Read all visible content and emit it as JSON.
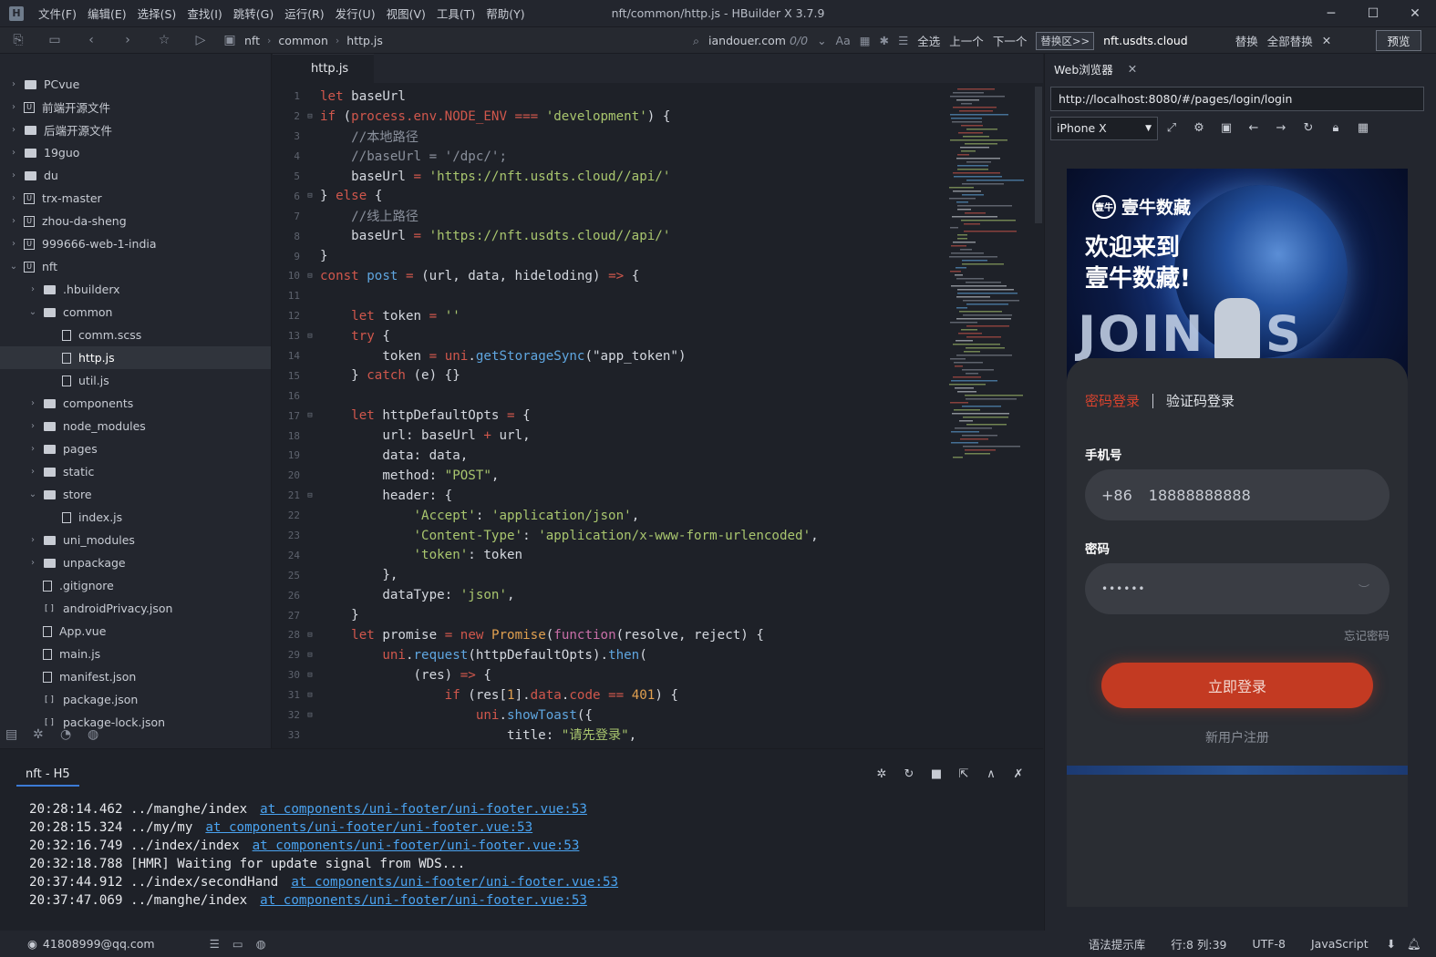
{
  "titlebar": {
    "menus": [
      "文件(F)",
      "编辑(E)",
      "选择(S)",
      "查找(I)",
      "跳转(G)",
      "运行(R)",
      "发行(U)",
      "视图(V)",
      "工具(T)",
      "帮助(Y)"
    ],
    "title": "nft/common/http.js - HBuilder X 3.7.9"
  },
  "toolbar": {
    "breadcrumb": [
      "nft",
      "common",
      "http.js"
    ],
    "find_text": "iandouer.com",
    "find_count": "0/0",
    "aa": "Aa",
    "select_all": "全选",
    "prev": "上一个",
    "next": "下一个",
    "replace_tag": "替换区>>",
    "replace_text": "nft.usdts.cloud",
    "replace": "替换",
    "replace_all": "全部替换",
    "preview": "预览"
  },
  "sidebar": {
    "items": [
      {
        "label": "PCvue",
        "depth": 0,
        "type": "folder",
        "chev": "›"
      },
      {
        "label": "前端开源文件",
        "depth": 0,
        "type": "proj",
        "chev": "›"
      },
      {
        "label": "后端开源文件",
        "depth": 0,
        "type": "folder",
        "chev": "›"
      },
      {
        "label": "19guo",
        "depth": 0,
        "type": "folder",
        "chev": "›"
      },
      {
        "label": "du",
        "depth": 0,
        "type": "folder",
        "chev": "›"
      },
      {
        "label": "trx-master",
        "depth": 0,
        "type": "proj",
        "chev": "›"
      },
      {
        "label": "zhou-da-sheng",
        "depth": 0,
        "type": "proj",
        "chev": "›"
      },
      {
        "label": "999666-web-1-india",
        "depth": 0,
        "type": "proj",
        "chev": "›"
      },
      {
        "label": "nft",
        "depth": 0,
        "type": "proj",
        "chev": "⌄"
      },
      {
        "label": ".hbuilderx",
        "depth": 1,
        "type": "folder",
        "chev": "›"
      },
      {
        "label": "common",
        "depth": 1,
        "type": "folder",
        "chev": "⌄"
      },
      {
        "label": "comm.scss",
        "depth": 2,
        "type": "file",
        "chev": ""
      },
      {
        "label": "http.js",
        "depth": 2,
        "type": "file",
        "chev": "",
        "selected": true
      },
      {
        "label": "util.js",
        "depth": 2,
        "type": "file",
        "chev": ""
      },
      {
        "label": "components",
        "depth": 1,
        "type": "folder",
        "chev": "›"
      },
      {
        "label": "node_modules",
        "depth": 1,
        "type": "folder",
        "chev": "›"
      },
      {
        "label": "pages",
        "depth": 1,
        "type": "folder",
        "chev": "›"
      },
      {
        "label": "static",
        "depth": 1,
        "type": "folder",
        "chev": "›"
      },
      {
        "label": "store",
        "depth": 1,
        "type": "folder",
        "chev": "⌄"
      },
      {
        "label": "index.js",
        "depth": 2,
        "type": "file",
        "chev": ""
      },
      {
        "label": "uni_modules",
        "depth": 1,
        "type": "folder",
        "chev": "›"
      },
      {
        "label": "unpackage",
        "depth": 1,
        "type": "folder",
        "chev": "›"
      },
      {
        "label": ".gitignore",
        "depth": 1,
        "type": "file",
        "chev": ""
      },
      {
        "label": "androidPrivacy.json",
        "depth": 1,
        "type": "json",
        "chev": ""
      },
      {
        "label": "App.vue",
        "depth": 1,
        "type": "file",
        "chev": ""
      },
      {
        "label": "main.js",
        "depth": 1,
        "type": "file",
        "chev": ""
      },
      {
        "label": "manifest.json",
        "depth": 1,
        "type": "file",
        "chev": ""
      },
      {
        "label": "package.json",
        "depth": 1,
        "type": "json",
        "chev": ""
      },
      {
        "label": "package-lock.json",
        "depth": 1,
        "type": "json",
        "chev": ""
      }
    ]
  },
  "editor": {
    "tab": "http.js",
    "lines": [
      [
        {
          "t": "let ",
          "c": "k"
        },
        {
          "t": "baseUrl",
          "c": "p"
        }
      ],
      [
        {
          "t": "if ",
          "c": "k"
        },
        {
          "t": "(",
          "c": "p"
        },
        {
          "t": "process.env.NODE_ENV ",
          "c": "pl"
        },
        {
          "t": "=== ",
          "c": "k"
        },
        {
          "t": "'development'",
          "c": "s"
        },
        {
          "t": ") {",
          "c": "p"
        }
      ],
      [
        {
          "t": "    //本地路径",
          "c": "c"
        }
      ],
      [
        {
          "t": "    //baseUrl = '/dpc/';",
          "c": "c"
        }
      ],
      [
        {
          "t": "    baseUrl ",
          "c": "p"
        },
        {
          "t": "= ",
          "c": "k"
        },
        {
          "t": "'https://nft.usdts.cloud//api/'",
          "c": "s"
        }
      ],
      [
        {
          "t": "} ",
          "c": "p"
        },
        {
          "t": "else ",
          "c": "k"
        },
        {
          "t": "{",
          "c": "p"
        }
      ],
      [
        {
          "t": "    //线上路径",
          "c": "c"
        }
      ],
      [
        {
          "t": "    baseUrl ",
          "c": "p"
        },
        {
          "t": "= ",
          "c": "k"
        },
        {
          "t": "'https://nft.usdts.cloud//api/'",
          "c": "s"
        }
      ],
      [
        {
          "t": "}",
          "c": "p"
        }
      ],
      [
        {
          "t": "const ",
          "c": "k"
        },
        {
          "t": "post ",
          "c": "f"
        },
        {
          "t": "= ",
          "c": "k"
        },
        {
          "t": "(url, data, hideloding) ",
          "c": "p"
        },
        {
          "t": "=> ",
          "c": "k"
        },
        {
          "t": "{",
          "c": "p"
        }
      ],
      [
        {
          "t": "",
          "c": "p"
        }
      ],
      [
        {
          "t": "    let ",
          "c": "k"
        },
        {
          "t": "token ",
          "c": "p"
        },
        {
          "t": "= ",
          "c": "k"
        },
        {
          "t": "''",
          "c": "s"
        }
      ],
      [
        {
          "t": "    try ",
          "c": "k"
        },
        {
          "t": "{",
          "c": "p"
        }
      ],
      [
        {
          "t": "        token ",
          "c": "p"
        },
        {
          "t": "= ",
          "c": "k"
        },
        {
          "t": "uni",
          "c": "pl"
        },
        {
          "t": ".",
          "c": "p"
        },
        {
          "t": "getStorageSync",
          "c": "f"
        },
        {
          "t": "(\"app_token\")",
          "c": "p"
        }
      ],
      [
        {
          "t": "    } ",
          "c": "p"
        },
        {
          "t": "catch ",
          "c": "k"
        },
        {
          "t": "(e) {}",
          "c": "p"
        }
      ],
      [
        {
          "t": "",
          "c": "p"
        }
      ],
      [
        {
          "t": "    let ",
          "c": "k"
        },
        {
          "t": "httpDefaultOpts ",
          "c": "p"
        },
        {
          "t": "= ",
          "c": "k"
        },
        {
          "t": "{",
          "c": "p"
        }
      ],
      [
        {
          "t": "        url: baseUrl ",
          "c": "p"
        },
        {
          "t": "+ ",
          "c": "k"
        },
        {
          "t": "url,",
          "c": "p"
        }
      ],
      [
        {
          "t": "        data: data,",
          "c": "p"
        }
      ],
      [
        {
          "t": "        method: ",
          "c": "p"
        },
        {
          "t": "\"POST\"",
          "c": "s"
        },
        {
          "t": ",",
          "c": "p"
        }
      ],
      [
        {
          "t": "        header: {",
          "c": "p"
        }
      ],
      [
        {
          "t": "            ",
          "c": "p"
        },
        {
          "t": "'Accept'",
          "c": "s"
        },
        {
          "t": ": ",
          "c": "p"
        },
        {
          "t": "'application/json'",
          "c": "s"
        },
        {
          "t": ",",
          "c": "p"
        }
      ],
      [
        {
          "t": "            ",
          "c": "p"
        },
        {
          "t": "'Content-Type'",
          "c": "s"
        },
        {
          "t": ": ",
          "c": "p"
        },
        {
          "t": "'application/x-www-form-urlencoded'",
          "c": "s"
        },
        {
          "t": ",",
          "c": "p"
        }
      ],
      [
        {
          "t": "            ",
          "c": "p"
        },
        {
          "t": "'token'",
          "c": "s"
        },
        {
          "t": ": token",
          "c": "p"
        }
      ],
      [
        {
          "t": "        },",
          "c": "p"
        }
      ],
      [
        {
          "t": "        dataType: ",
          "c": "p"
        },
        {
          "t": "'json'",
          "c": "s"
        },
        {
          "t": ",",
          "c": "p"
        }
      ],
      [
        {
          "t": "    }",
          "c": "p"
        }
      ],
      [
        {
          "t": "    let ",
          "c": "k"
        },
        {
          "t": "promise ",
          "c": "p"
        },
        {
          "t": "= ",
          "c": "k"
        },
        {
          "t": "new ",
          "c": "k"
        },
        {
          "t": "Promise",
          "c": "n"
        },
        {
          "t": "(",
          "c": "p"
        },
        {
          "t": "function",
          "c": "kw"
        },
        {
          "t": "(resolve, reject) {",
          "c": "p"
        }
      ],
      [
        {
          "t": "        uni",
          "c": "pl"
        },
        {
          "t": ".",
          "c": "p"
        },
        {
          "t": "request",
          "c": "f"
        },
        {
          "t": "(httpDefaultOpts).",
          "c": "p"
        },
        {
          "t": "then",
          "c": "f"
        },
        {
          "t": "(",
          "c": "p"
        }
      ],
      [
        {
          "t": "            (res) ",
          "c": "p"
        },
        {
          "t": "=> ",
          "c": "k"
        },
        {
          "t": "{",
          "c": "p"
        }
      ],
      [
        {
          "t": "                if ",
          "c": "k"
        },
        {
          "t": "(res[",
          "c": "p"
        },
        {
          "t": "1",
          "c": "n"
        },
        {
          "t": "].",
          "c": "p"
        },
        {
          "t": "data",
          "c": "pl"
        },
        {
          "t": ".",
          "c": "p"
        },
        {
          "t": "code ",
          "c": "pl"
        },
        {
          "t": "== ",
          "c": "k"
        },
        {
          "t": "401",
          "c": "n"
        },
        {
          "t": ") {",
          "c": "p"
        }
      ],
      [
        {
          "t": "                    uni",
          "c": "pl"
        },
        {
          "t": ".",
          "c": "p"
        },
        {
          "t": "showToast",
          "c": "f"
        },
        {
          "t": "({",
          "c": "p"
        }
      ],
      [
        {
          "t": "                        title: ",
          "c": "p"
        },
        {
          "t": "\"请先登录\"",
          "c": "s"
        },
        {
          "t": ",",
          "c": "p"
        }
      ]
    ],
    "folds": [
      2,
      6,
      10,
      13,
      17,
      21,
      28,
      29,
      30,
      31,
      32
    ]
  },
  "browser": {
    "tab": "Web浏览器",
    "url": "http://localhost:8080/#/pages/login/login",
    "device": "iPhone X",
    "app": {
      "brand": "壹牛数藏",
      "brand_logo": "壹牛",
      "welcome_line1": "欢迎来到",
      "welcome_line2": "壹牛数藏!",
      "banner_text": "JOIN US",
      "tab_password": "密码登录",
      "tab_code": "验证码登录",
      "phone_label": "手机号",
      "country_code": "+86",
      "phone_value": "18888888888",
      "password_label": "密码",
      "password_value": "••••••",
      "forgot": "忘记密码",
      "login_button": "立即登录",
      "register": "新用户注册"
    }
  },
  "console": {
    "tab": "nft - H5",
    "logs": [
      {
        "time": "20:28:14.462",
        "path": "../manghe/index",
        "link": "at components/uni-footer/uni-footer.vue:53"
      },
      {
        "time": "20:28:15.324",
        "path": "../my/my",
        "link": "at components/uni-footer/uni-footer.vue:53"
      },
      {
        "time": "20:32:16.749",
        "path": "../index/index",
        "link": "at components/uni-footer/uni-footer.vue:53"
      },
      {
        "time": "20:32:18.788",
        "path": "[HMR] Waiting for update signal from WDS...",
        "link": ""
      },
      {
        "time": "20:37:44.912",
        "path": "../index/secondHand",
        "link": "at components/uni-footer/uni-footer.vue:53"
      },
      {
        "time": "20:37:47.069",
        "path": "../manghe/index",
        "link": "at components/uni-footer/uni-footer.vue:53"
      }
    ]
  },
  "statusbar": {
    "user": "41808999@qq.com",
    "grammar": "语法提示库",
    "position": "行:8  列:39",
    "encoding": "UTF-8",
    "language": "JavaScript"
  }
}
